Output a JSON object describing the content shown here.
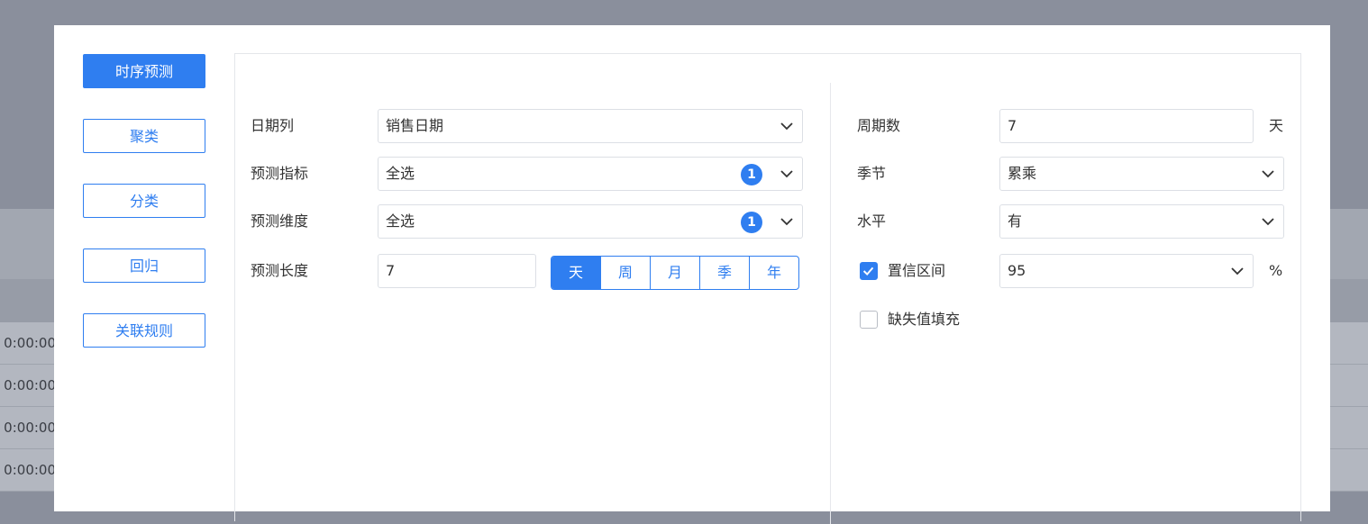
{
  "background": {
    "rows": [
      "0:00:00",
      "0:00:00",
      "0:00:00",
      "0:00:00"
    ]
  },
  "nav": {
    "items": [
      {
        "label": "时序预测",
        "active": true
      },
      {
        "label": "聚类",
        "active": false
      },
      {
        "label": "分类",
        "active": false
      },
      {
        "label": "回归",
        "active": false
      },
      {
        "label": "关联规则",
        "active": false
      }
    ]
  },
  "left_form": {
    "date_column": {
      "label": "日期列",
      "value": "销售日期"
    },
    "forecast_metric": {
      "label": "预测指标",
      "value": "全选",
      "badge": "1"
    },
    "forecast_dimension": {
      "label": "预测维度",
      "value": "全选",
      "badge": "1"
    },
    "forecast_length": {
      "label": "预测长度",
      "value": "7",
      "units": [
        "天",
        "周",
        "月",
        "季",
        "年"
      ],
      "selected_unit": "天"
    }
  },
  "right_form": {
    "periods": {
      "label": "周期数",
      "value": "7",
      "unit": "天"
    },
    "season": {
      "label": "季节",
      "value": "累乘"
    },
    "level": {
      "label": "水平",
      "value": "有"
    },
    "confidence_interval": {
      "label": "置信区间",
      "checked": true,
      "value": "95",
      "unit": "%"
    },
    "missing_fill": {
      "label": "缺失值填充",
      "checked": false
    }
  },
  "colors": {
    "accent": "#2f7ef0",
    "overlay": "#8a8f9c"
  },
  "icons": {
    "dropdown": "chevron-down-icon",
    "check": "check-icon"
  }
}
